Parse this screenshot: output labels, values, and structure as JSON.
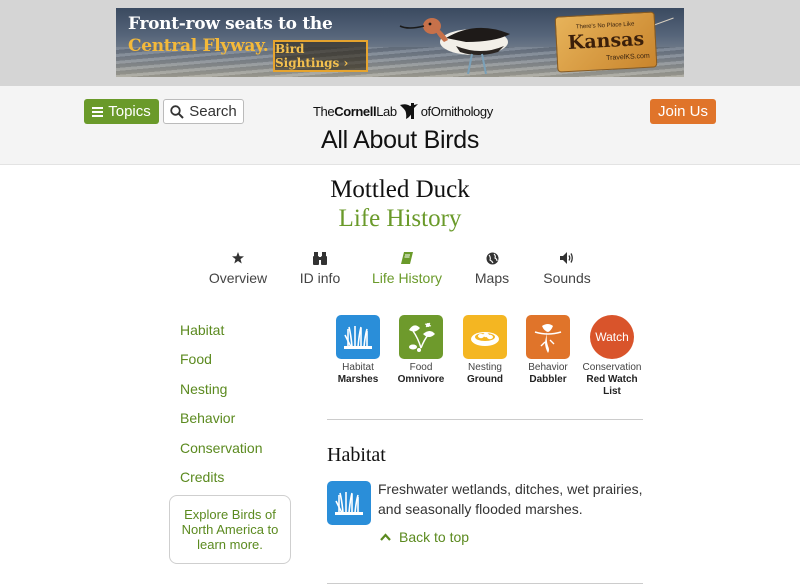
{
  "ad": {
    "line1": "Front-row seats to the",
    "line2": "Central Flyway.",
    "button": "Bird Sightings ›",
    "tag_small": "There's No Place Like",
    "tag_big": "Kansas",
    "tag_url": "TravelKS.com"
  },
  "header": {
    "topics_label": "Topics",
    "search_label": "Search",
    "join_label": "Join Us",
    "logo": {
      "the": "The",
      "cornell": "Cornell",
      "lab": "Lab",
      "of": "of",
      "orn": "Ornithology"
    },
    "site_title": "All About Birds"
  },
  "species": {
    "name": "Mottled Duck",
    "section": "Life History"
  },
  "tabs": [
    {
      "label": "Overview",
      "icon": "star-icon"
    },
    {
      "label": "ID info",
      "icon": "binoculars-icon"
    },
    {
      "label": "Life History",
      "icon": "book-icon",
      "active": true
    },
    {
      "label": "Maps",
      "icon": "globe-icon"
    },
    {
      "label": "Sounds",
      "icon": "speaker-icon"
    }
  ],
  "side_nav": [
    "Habitat",
    "Food",
    "Nesting",
    "Behavior",
    "Conservation",
    "Credits"
  ],
  "explore": "Explore Birds of North America to learn more.",
  "badges": [
    {
      "category": "Habitat",
      "value": "Marshes",
      "color": "#2a8ed9",
      "icon": "marsh-icon"
    },
    {
      "category": "Food",
      "value": "Omnivore",
      "color": "#6e9a2c",
      "icon": "omnivore-icon"
    },
    {
      "category": "Nesting",
      "value": "Ground",
      "color": "#f4b622",
      "icon": "ground-nest-icon"
    },
    {
      "category": "Behavior",
      "value": "Dabbler",
      "color": "#e0742a",
      "icon": "dabbler-icon"
    },
    {
      "category": "Conservation",
      "value": "Red Watch List",
      "color": "#d9542b",
      "icon_text": "Watch"
    }
  ],
  "habitat": {
    "title": "Habitat",
    "text": "Freshwater wetlands, ditches, wet prairies, and seasonally flooded marshes.",
    "back_to_top": "Back to top"
  }
}
